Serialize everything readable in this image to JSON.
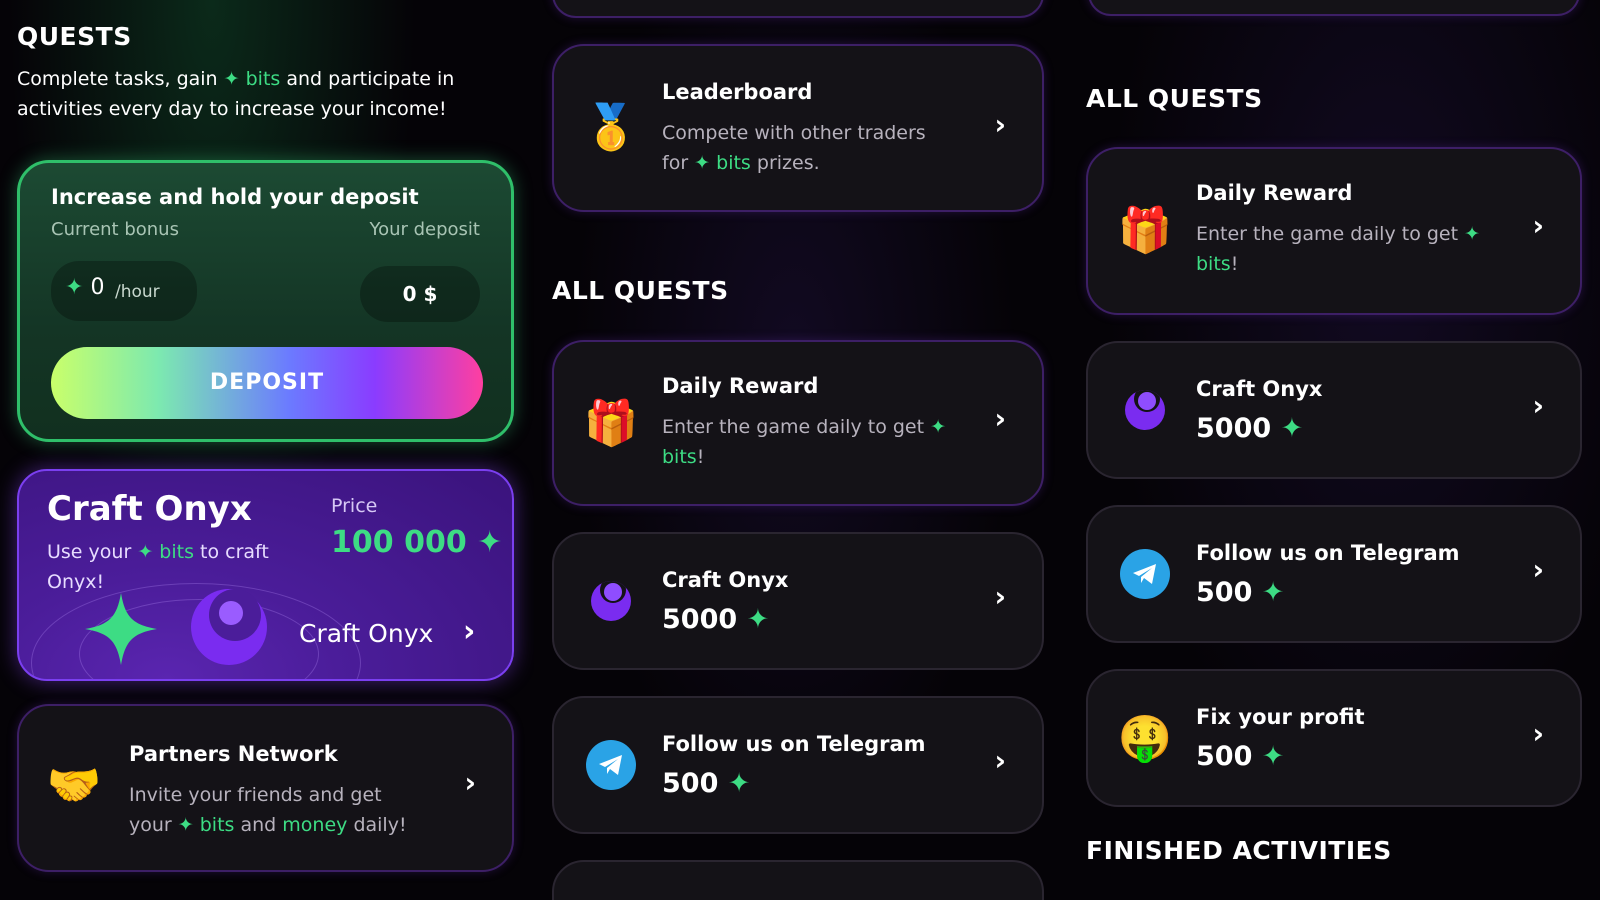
{
  "col1": {
    "title": "QUESTS",
    "intro": {
      "part1": "Complete tasks, gain",
      "bits": "bits",
      "part2": "and participate in activities every day to increase your income!"
    },
    "deposit": {
      "title": "Increase and hold your deposit",
      "bonus_label": "Current bonus",
      "deposit_label": "Your deposit",
      "bonus_value": "0",
      "bonus_unit": "/hour",
      "deposit_value": "0 $",
      "button": "DEPOSIT"
    },
    "craft_onyx": {
      "title": "Craft Onyx",
      "desc_prefix": "Use your",
      "desc_bits": "bits",
      "desc_suffix": "to craft Onyx!",
      "price_label": "Price",
      "price_value": "100 000",
      "cta": "Craft Onyx"
    },
    "partners": {
      "title": "Partners Network",
      "desc1": "Invite your friends and get",
      "desc2_a": "your",
      "desc2_bits": "bits",
      "desc2_b": "and",
      "desc2_money": "money",
      "desc2_c": "daily!"
    }
  },
  "col2": {
    "leaderboard": {
      "title": "Leaderboard",
      "desc1": "Compete with other traders",
      "desc2_a": "for",
      "desc2_bits": "bits",
      "desc2_b": "prizes."
    },
    "all_quests_title": "ALL QUESTS",
    "quests": [
      {
        "title": "Daily Reward",
        "desc1": "Enter the game daily to get",
        "desc2": "bits",
        "desc2_end": "!"
      },
      {
        "title": "Craft Onyx",
        "value": "5000"
      },
      {
        "title": "Follow us on Telegram",
        "value": "500"
      }
    ]
  },
  "col3": {
    "all_quests_title": "ALL QUESTS",
    "quests": [
      {
        "title": "Daily Reward",
        "desc1": "Enter the game daily to get",
        "desc2": "bits",
        "desc2_end": "!"
      },
      {
        "title": "Craft Onyx",
        "value": "5000"
      },
      {
        "title": "Follow us on Telegram",
        "value": "500"
      },
      {
        "title": "Fix your profit",
        "value": "500"
      }
    ],
    "finished_title": "FINISHED ACTIVITIES"
  },
  "icons": {
    "star": "✦",
    "chevron": "›",
    "gift": "🎁",
    "medal": "🥇",
    "handshake": "🤝",
    "money_face": "🤑"
  },
  "colors": {
    "accent_green": "#3ddc84",
    "accent_purple": "#7a2cf0",
    "telegram_blue": "#2aa3e6"
  }
}
